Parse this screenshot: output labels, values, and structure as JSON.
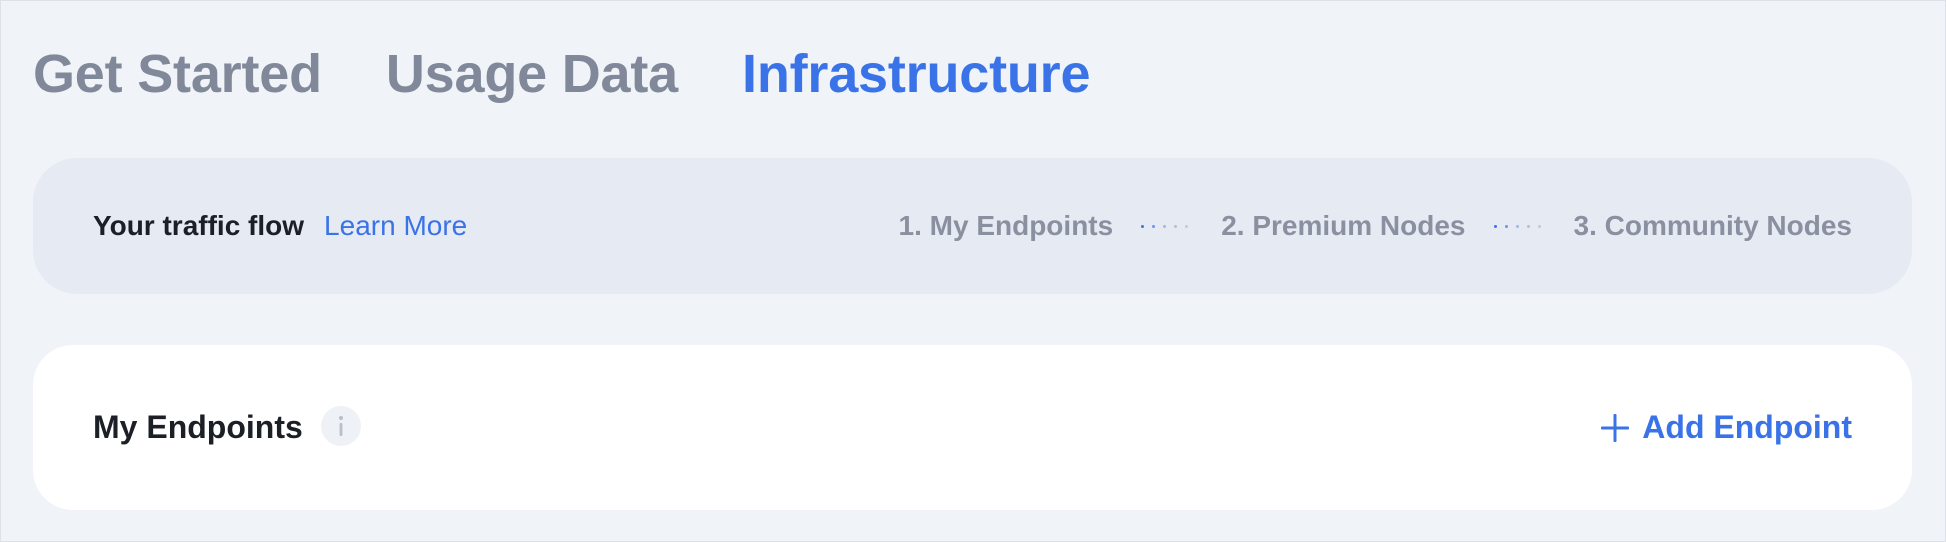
{
  "tabs": [
    {
      "label": "Get Started",
      "active": false
    },
    {
      "label": "Usage Data",
      "active": false
    },
    {
      "label": "Infrastructure",
      "active": true
    }
  ],
  "traffic_flow": {
    "title": "Your traffic flow",
    "learn_more": "Learn More",
    "steps": [
      "1. My Endpoints",
      "2. Premium Nodes",
      "3. Community Nodes"
    ]
  },
  "endpoints_card": {
    "title": "My Endpoints",
    "info_icon": "info-icon",
    "add_icon": "plus-icon",
    "add_label": "Add Endpoint"
  },
  "colors": {
    "accent": "#3a73e8",
    "inactive_tab": "#80889a",
    "page_background": "#f0f3f8",
    "banner_background": "#e6eaf3",
    "card_background": "#ffffff"
  }
}
